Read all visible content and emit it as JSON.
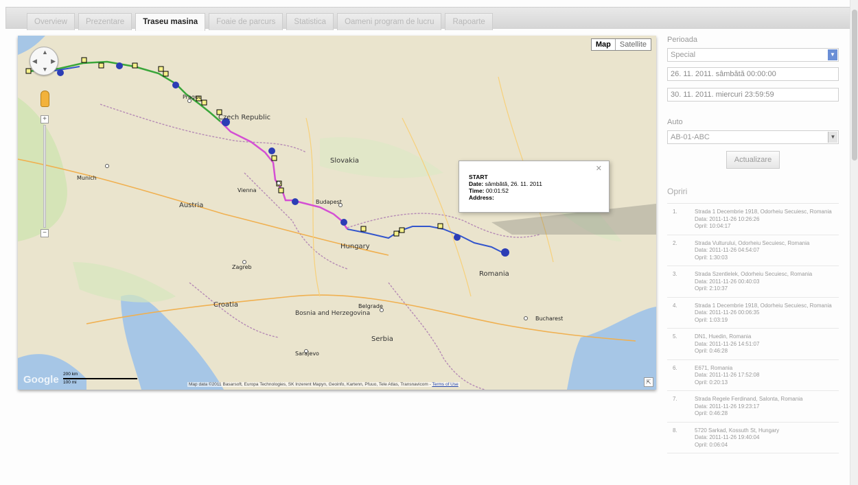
{
  "tabs": [
    {
      "label": "Overview",
      "active": false
    },
    {
      "label": "Prezentare",
      "active": false
    },
    {
      "label": "Traseu masina",
      "active": true
    },
    {
      "label": "Foaie de parcurs",
      "active": false
    },
    {
      "label": "Statistica",
      "active": false
    },
    {
      "label": "Oameni program de lucru",
      "active": false
    },
    {
      "label": "Rapoarte",
      "active": false
    }
  ],
  "map": {
    "type_map": "Map",
    "type_satellite": "Satellite",
    "countries": [
      "Czech Republic",
      "Slovakia",
      "Austria",
      "Hungary",
      "Croatia",
      "Bosnia and Herzegovina",
      "Serbia",
      "Romania",
      "Vienna",
      "Budapest",
      "Zagreb",
      "Prague",
      "Munich",
      "Bucharest",
      "Sarajevo",
      "Belgrade"
    ],
    "popup": {
      "title": "START",
      "date_label": "Date:",
      "date_value": "sâmbătă, 26. 11. 2011",
      "time_label": "Time:",
      "time_value": "00:01:52",
      "address_label": "Address:"
    },
    "attribution": "Map data ©2011 Basarsoft, Europa Technologies, SK Inzerent Mapyn, Geoinfo, Kartenn, Pfuuo, Tele Atlas, Transnavicom -",
    "terms": "Terms of Use",
    "scale_top": "200 km",
    "scale_bottom": "100 mi",
    "google": "Google"
  },
  "sidebar": {
    "period_label": "Perioada",
    "period_value": "Special",
    "date_from": "26. 11. 2011. sâmbătă 00:00:00",
    "date_to": "30. 11. 2011. miercuri 23:59:59",
    "auto_label": "Auto",
    "auto_value": "AB-01-ABC",
    "update_button": "Actualizare",
    "stops_title": "Opriri",
    "stops": [
      {
        "num": "1.",
        "address": "Strada 1 Decembrie 1918, Odorheiu Secuiesc, Romania",
        "date": "Data: 2011-11-26 10:26:26",
        "duration": "Opril: 10:04:17"
      },
      {
        "num": "2.",
        "address": "Strada Vulturului, Odorheiu Secuiesc, Romania",
        "date": "Data: 2011-11-26 04:54:07",
        "duration": "Opril: 1:30:03"
      },
      {
        "num": "3.",
        "address": "Strada Szentlelek, Odorheiu Secuiesc, Romania",
        "date": "Data: 2011-11-26 00:40:03",
        "duration": "Opril: 2:10:37"
      },
      {
        "num": "4.",
        "address": "Strada 1 Decembrie 1918, Odorheiu Secuiesc, Romania",
        "date": "Data: 2011-11-26 00:06:35",
        "duration": "Opril: 1:03:19"
      },
      {
        "num": "5.",
        "address": "DN1, Huedin, Romania",
        "date": "Data: 2011-11-26 14:51:07",
        "duration": "Opril: 0:46:28"
      },
      {
        "num": "6.",
        "address": "E671, Romania",
        "date": "Data: 2011-11-26 17:52:08",
        "duration": "Opril: 0:20:13"
      },
      {
        "num": "7.",
        "address": "Strada Regele Ferdinand, Salonta, Romania",
        "date": "Data: 2011-11-26 19:23:17",
        "duration": "Opril: 0:46:28"
      },
      {
        "num": "8.",
        "address": "5720 Sarkad, Kossuth St, Hungary",
        "date": "Data: 2011-11-26 19:40:04",
        "duration": "Opril: 0:06:04"
      }
    ]
  },
  "colors": {
    "accent": "#6b8fd6",
    "route_blue": "#3355cc",
    "route_pink": "#d44fd4",
    "route_green": "#3aa63a",
    "water": "#a6c6e6",
    "land": "#eae4cd"
  }
}
